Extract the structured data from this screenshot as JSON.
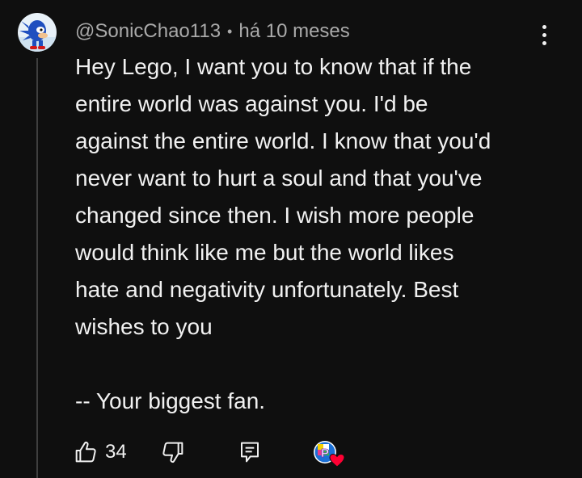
{
  "comment": {
    "author": "@SonicChao113",
    "separator": "•",
    "timestamp": "há 10 meses",
    "body_lines": [
      "Hey Lego, I want you to know that if the",
      "entire world was against you. I'd be",
      "against the entire world. I know that you'd",
      "never want to hurt a soul and that you've",
      "changed since then. I wish more people",
      "would think like me but the world likes",
      "hate and negativity unfortunately. Best",
      "wishes to you"
    ],
    "signature": "-- Your biggest fan.",
    "like_count": "34"
  },
  "icons": {
    "like": "thumbs-up-icon",
    "dislike": "thumbs-down-icon",
    "reply": "reply-icon",
    "menu": "more-vertical-icon",
    "heart": "creator-heart-icon"
  },
  "colors": {
    "background": "#0f0f0f",
    "text": "#f1f1f1",
    "secondary_text": "#aaaaaa",
    "thread_line": "#3f3f3f",
    "heart": "#ff0033"
  }
}
